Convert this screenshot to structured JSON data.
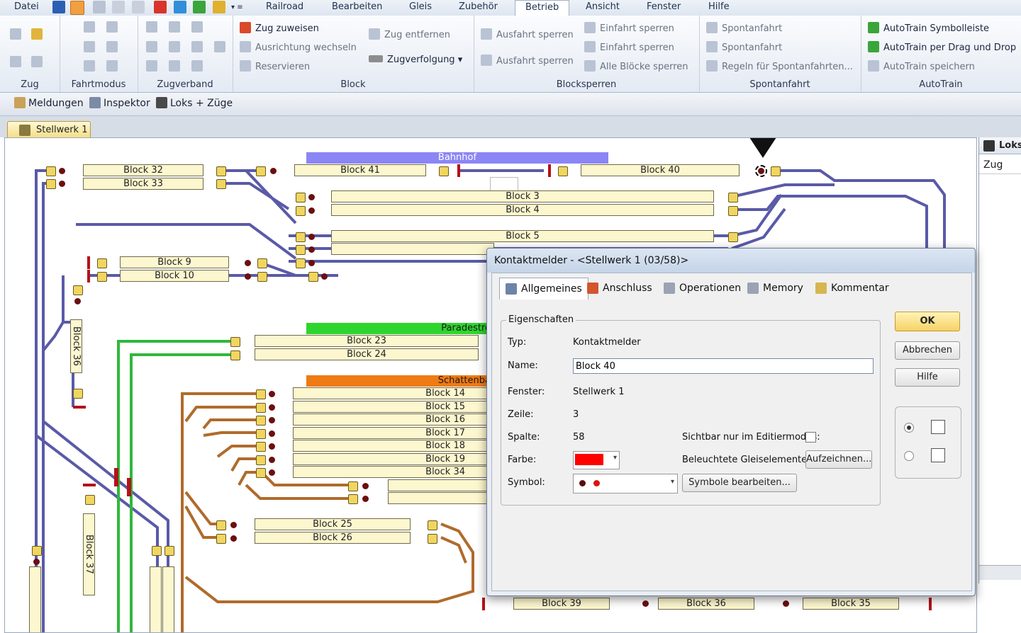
{
  "menu": [
    "Datei",
    "Railroad",
    "Bearbeiten",
    "Gleis",
    "Zubehör",
    "Betrieb",
    "Ansicht",
    "Fenster",
    "Hilfe"
  ],
  "menu_active": "Betrieb",
  "ribbon": {
    "groups": {
      "zug": "Zug",
      "fahrtmodus": "Fahrtmodus",
      "zugverband": "Zugverband",
      "block": "Block",
      "blocksperren": "Blocksperren",
      "spontanfahrt": "Spontanfahrt",
      "autotrain": "AutoTrain"
    },
    "block_buttons": [
      "Zug zuweisen",
      "Ausrichtung wechseln",
      "Reservieren",
      "Zug entfernen",
      "Zugverfolgung"
    ],
    "blocksperren_buttons": [
      "Ausfahrt sperren",
      "Ausfahrt sperren",
      "Einfahrt sperren",
      "Einfahrt sperren",
      "Alle Blöcke sperren"
    ],
    "spontanfahrt_buttons": [
      "Spontanfahrt",
      "Spontanfahrt",
      "Regeln für Spontanfahrten..."
    ],
    "autotrain_buttons": [
      "AutoTrain Symbolleiste",
      "AutoTrain per Drag und Drop",
      "AutoTrain speichern"
    ]
  },
  "toolbar": [
    "Meldungen",
    "Inspektor",
    "Loks + Züge"
  ],
  "doc_tab": "Stellwerk 1",
  "track": {
    "blocks": [
      "Block 32",
      "Block 33",
      "Block 41",
      "Block 40",
      "Block 3",
      "Block 4",
      "Block 5",
      "Block 9",
      "Block 10",
      "Block 23",
      "Block 24",
      "Block 14",
      "Block 15",
      "Block 16",
      "Block 17",
      "Block 18",
      "Block 19",
      "Block 34",
      "Block 25",
      "Block 26",
      "Block 39",
      "Block 36",
      "Block 35"
    ],
    "vertical_blocks": [
      "Block 36",
      "Block 37"
    ],
    "banners": {
      "bahnhof": "Bahnhof",
      "parade": "Paradestre",
      "schatten": "Schattenba"
    },
    "colors": {
      "bahnhof": "#8b86f5",
      "parade": "#2fd52f",
      "schatten": "#f07a14",
      "main_track": "#5a5aa8",
      "yard_track": "#b06b2b",
      "green_track": "#2fb83a"
    }
  },
  "lok_panel": {
    "title": "Loks",
    "column": "Zug"
  },
  "dialog": {
    "title": "Kontaktmelder - <Stellwerk 1 (03/58)>",
    "tabs": [
      "Allgemeines",
      "Anschluss",
      "Operationen",
      "Memory",
      "Kommentar"
    ],
    "group_title": "Eigenschaften",
    "fields": {
      "typ_label": "Typ:",
      "typ_value": "Kontaktmelder",
      "name_label": "Name:",
      "name_value": "Block 40",
      "fenster_label": "Fenster:",
      "fenster_value": "Stellwerk 1",
      "zeile_label": "Zeile:",
      "zeile_value": "3",
      "spalte_label": "Spalte:",
      "spalte_value": "58",
      "farbe_label": "Farbe:",
      "farbe_value": "#ff0000",
      "symbol_label": "Symbol:",
      "sichtbar_label": "Sichtbar nur im Editiermodus:",
      "beleuchtet_label": "Beleuchtete Gleiselemente:"
    },
    "buttons": {
      "ok": "OK",
      "abbrechen": "Abbrechen",
      "hilfe": "Hilfe",
      "aufzeichnen": "Aufzeichnen...",
      "symbole": "Symbole bearbeiten..."
    }
  }
}
